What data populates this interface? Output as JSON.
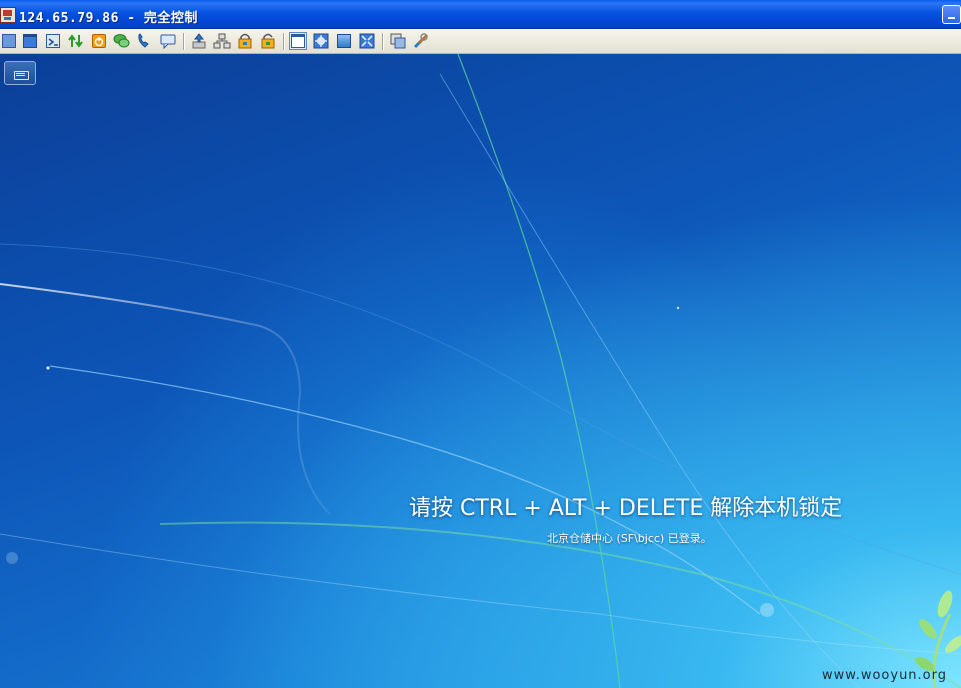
{
  "window": {
    "title": "124.65.79.86 - 完全控制"
  },
  "toolbar": {
    "buttons": [
      {
        "name": "send-ctrl-alt-del-icon"
      },
      {
        "name": "screen-icon"
      },
      {
        "name": "terminal-icon"
      },
      {
        "name": "file-transfer-icon"
      },
      {
        "name": "power-icon"
      },
      {
        "name": "chat-icon"
      },
      {
        "name": "phone-icon"
      },
      {
        "name": "message-icon"
      },
      {
        "name": "upload-icon"
      },
      {
        "name": "network-icon"
      },
      {
        "name": "lock-icon"
      },
      {
        "name": "unlock-icon"
      },
      {
        "name": "window-mode-icon"
      },
      {
        "name": "fit-screen-icon"
      },
      {
        "name": "fullscreen-icon"
      },
      {
        "name": "scale-icon"
      },
      {
        "name": "copy-icon"
      },
      {
        "name": "settings-tools-icon"
      }
    ]
  },
  "desktop": {
    "lock_message": "请按 CTRL + ALT + DELETE 解除本机锁定",
    "logon_info": "北京仓储中心 (SF\\bjcc) 已登录。"
  },
  "watermark": "www.wooyun.org",
  "colors": {
    "titlebar": "#0553e0",
    "toolbar": "#ece9d8",
    "desktop_dark": "#0b3f98",
    "desktop_light": "#7fe6ff"
  }
}
